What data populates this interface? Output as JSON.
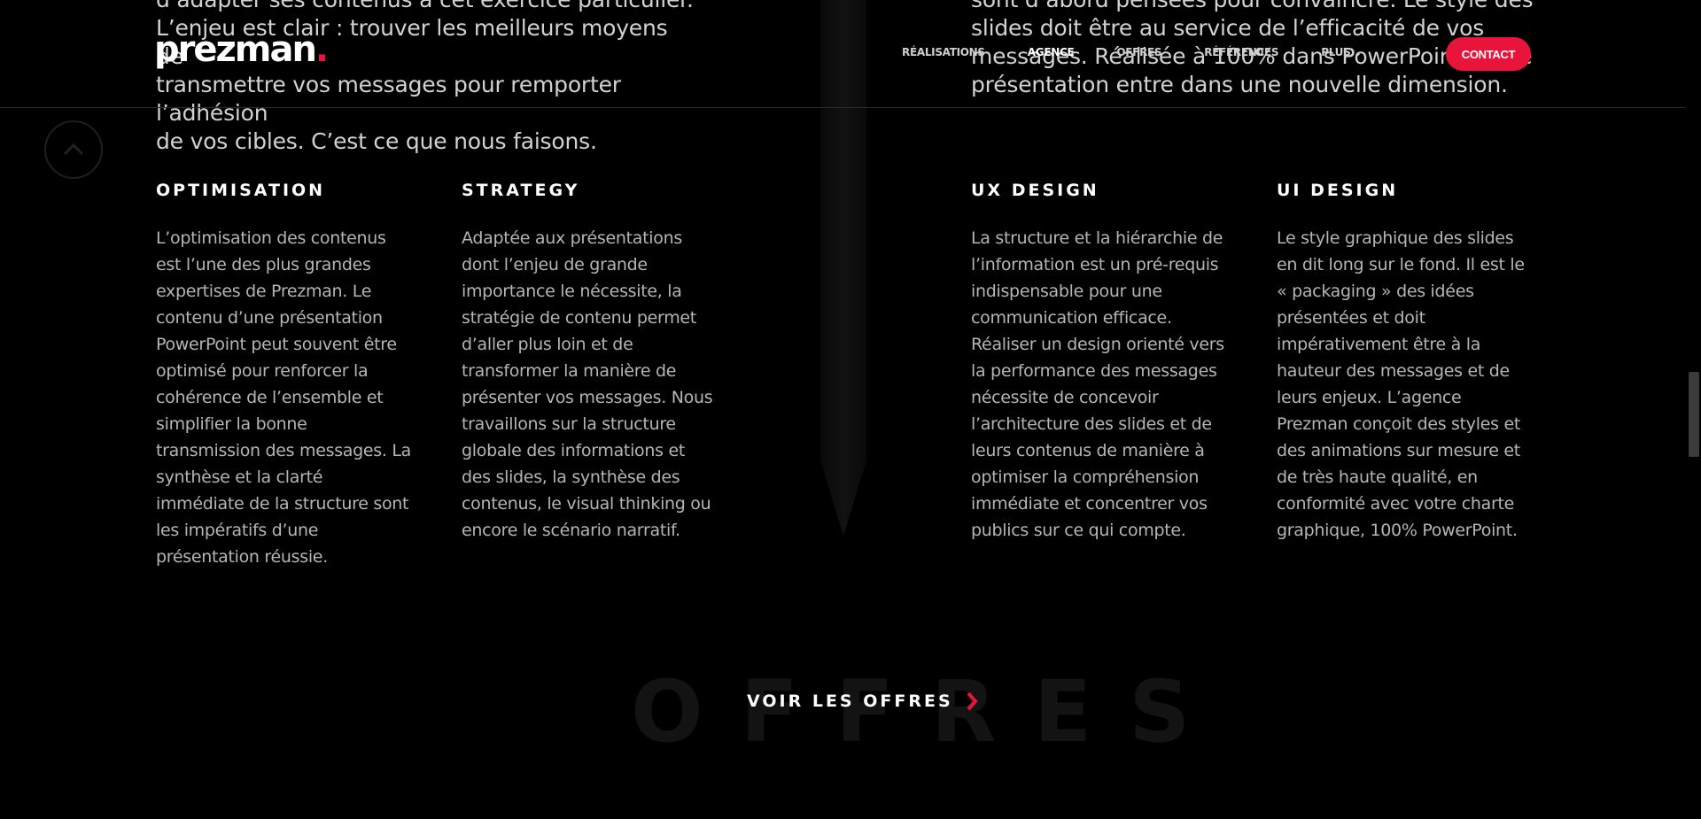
{
  "intro": {
    "left_lines": [
      "d’adapter ses contenus à cet exercice particulier.",
      "L’enjeu est clair : trouver les meilleurs moyens de",
      "transmettre vos messages pour remporter l’adhésion",
      "de vos cibles. C’est ce que nous faisons."
    ],
    "right_lines": [
      "sont d’abord pensées pour convaincre. Le style des",
      "slides doit être au service de l’efficacité de vos",
      "messages. Réalisée à 100% dans PowerPoint, votre",
      "présentation entre dans une nouvelle dimension."
    ]
  },
  "header": {
    "logo": "prezman",
    "logo_dot": ".",
    "nav": [
      {
        "label": "RÉALISATIONS"
      },
      {
        "label": "AGENCE"
      },
      {
        "label": "OFFRES"
      },
      {
        "label": "RÉFÉRENCES"
      },
      {
        "label": "PLUS"
      }
    ],
    "contact_label": "CONTACT"
  },
  "columns": [
    {
      "title": "OPTIMISATION",
      "text": "L’optimisation des contenus est l’une des plus grandes expertises de Prezman. Le contenu d’une présentation PowerPoint peut souvent être optimisé pour renforcer la cohérence de l’ensemble et simplifier la bonne transmission des messages. La synthèse et la clarté immédiate de la structure sont les impératifs d’une présentation réussie."
    },
    {
      "title": "STRATEGY",
      "text": "Adaptée aux présentations dont l’enjeu de grande importance le nécessite, la stratégie de contenu permet d’aller plus loin et de transformer la manière de présenter vos messages. Nous travaillons sur la structure globale des informations et des slides, la synthèse des contenus, le visual thinking ou encore le scénario narratif."
    },
    {
      "title": "UX DESIGN",
      "text": "La structure et la hiérarchie de l’information est un pré-requis indispensable pour une communication efficace. Réaliser un design orienté vers la performance des messages nécessite de concevoir l’architecture des slides et de leurs contenus de manière à optimiser la compréhension immédiate et concentrer vos publics sur ce qui compte."
    },
    {
      "title": "UI DESIGN",
      "text": "Le style graphique des slides en dit long sur le fond. Il est le « packaging » des idées présentées et doit impérativement être à la hauteur des messages et de leurs enjeux. L’agence Prezman conçoit des styles et des animations sur mesure et de très haute qualité, en conformité avec votre charte graphique, 100% PowerPoint."
    }
  ],
  "offers": {
    "background_word": "OFFRES",
    "link_label": "VOIR LES OFFRES"
  },
  "colors": {
    "accent": "#e8143c",
    "background": "#000000",
    "text": "#b5b5b5"
  }
}
